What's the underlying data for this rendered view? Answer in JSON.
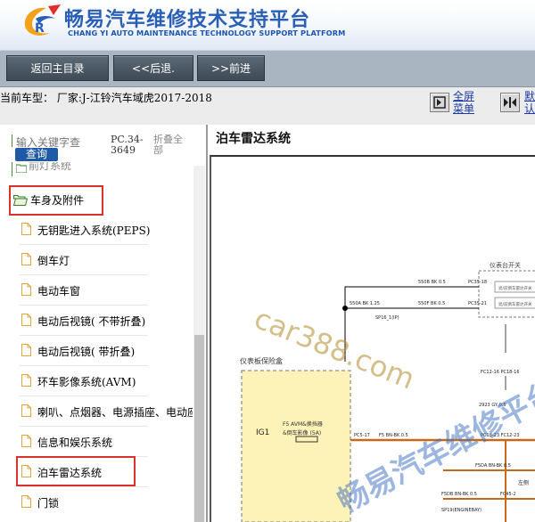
{
  "header": {
    "title": "畅易汽车维修技术支持平台",
    "subtitle": "CHANG YI AUTO MAINTENANCE TECHNOLOGY SUPPORT PLATFORM",
    "brand_color": "#2a5fb8"
  },
  "toolbar": {
    "home_label": "返回主目录",
    "back_label": "<<后退.",
    "forward_label": ">>前进"
  },
  "model": {
    "text": "当前车型： 厂家:J-江铃汽车域虎2017-2018"
  },
  "view_controls": {
    "fullscreen_label": "全屏\n菜单",
    "tile_label": "默\n认"
  },
  "sidebar": {
    "search_placeholder": "输入关键字查",
    "search_button": "查询",
    "version": "PC.34-3649",
    "collapse_all": "折叠全部",
    "partial_item": "前灯系统",
    "folder": "车身及附件",
    "items": [
      {
        "label": "无钥匙进入系统(PEPS)"
      },
      {
        "label": "倒车灯"
      },
      {
        "label": "电动车窗"
      },
      {
        "label": "电动后视镜( 不带折叠)"
      },
      {
        "label": "电动后视镜( 带折叠)"
      },
      {
        "label": "环车影像系统(AVM)"
      },
      {
        "label": "喇叭、点烟器、电源插座、电动座"
      },
      {
        "label": "信息和娱乐系统"
      },
      {
        "label": "泊车雷达系统"
      },
      {
        "label": "门锁"
      }
    ],
    "highlight_color": "#d9322c"
  },
  "content": {
    "title": "泊车雷达系统",
    "diagram": {
      "fuse_box_label": "仪表板保险盒",
      "ig_label": "IG1",
      "fuse_label": "F5 AVM&换挡器\n&倒车影像  (5A)",
      "switch_box_label": "仪表台开关",
      "switch_inner_1": "遮/前倒车雷达开关",
      "switch_inner_2": "遮/前倒车雷达开关",
      "sp_label": "SP16_1(IP)",
      "sp19_label": "SP19(ENGINEBAY)",
      "right_label": "左侧",
      "wires": [
        "550B BK 0.5",
        "PC35-18",
        "550A BK 1.25",
        "550F BK 0.5",
        "PC35-21",
        "FC12-16 PC18-16",
        "2923 GY 0.5",
        "PC5-17",
        "F5 BN-BK 0.5",
        "PC18-23 FC12-23",
        "F5DA BN-BK 0.5",
        "F5DB BN-BK 0.5",
        "FC45-2"
      ],
      "watermark_1": "car388.com",
      "watermark_2": "畅易汽车维修平台"
    }
  }
}
